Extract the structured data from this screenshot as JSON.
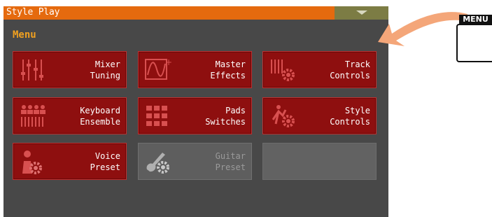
{
  "window": {
    "title": "Style Play",
    "dropdown_icon": "chevron-down-icon"
  },
  "menu": {
    "heading": "Menu"
  },
  "tiles": [
    {
      "line1": "Mixer",
      "line2": "Tuning",
      "icon": "sliders-icon",
      "enabled": true
    },
    {
      "line1": "Master",
      "line2": "Effects",
      "icon": "effects-wave-icon",
      "enabled": true
    },
    {
      "line1": "Track",
      "line2": "Controls",
      "icon": "track-gear-icon",
      "enabled": true
    },
    {
      "line1": "Keyboard",
      "line2": "Ensemble",
      "icon": "keyboard-ensemble-icon",
      "enabled": true
    },
    {
      "line1": "Pads",
      "line2": "Switches",
      "icon": "pads-grid-icon",
      "enabled": true
    },
    {
      "line1": "Style",
      "line2": "Controls",
      "icon": "style-gear-icon",
      "enabled": true
    },
    {
      "line1": "Voice",
      "line2": "Preset",
      "icon": "voice-gear-icon",
      "enabled": true
    },
    {
      "line1": "Guitar",
      "line2": "Preset",
      "icon": "guitar-gear-icon",
      "enabled": false
    }
  ],
  "hardware": {
    "menu_button_label": "MENU"
  },
  "colors": {
    "title_bar": "#e56a0e",
    "tile": "#8e0f0f",
    "panel": "#484848",
    "heading": "#f0a020",
    "arrow": "#f4a679"
  }
}
